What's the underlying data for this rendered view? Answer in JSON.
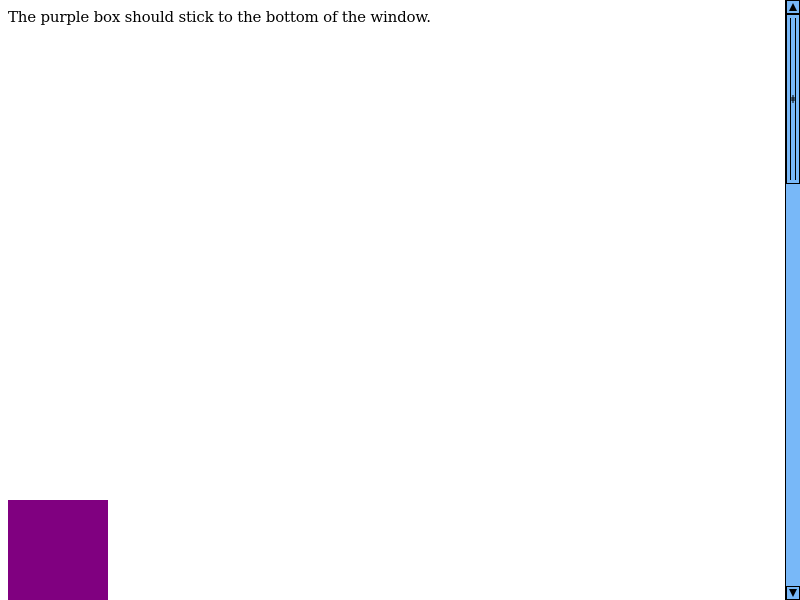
{
  "page": {
    "message": "The purple box should stick to the bottom of the window.",
    "box_color": "#800080"
  },
  "scrollbar": {
    "up_icon": "arrow-up-icon",
    "down_icon": "arrow-down-icon",
    "track_color": "#78b8f8",
    "position": 0
  }
}
